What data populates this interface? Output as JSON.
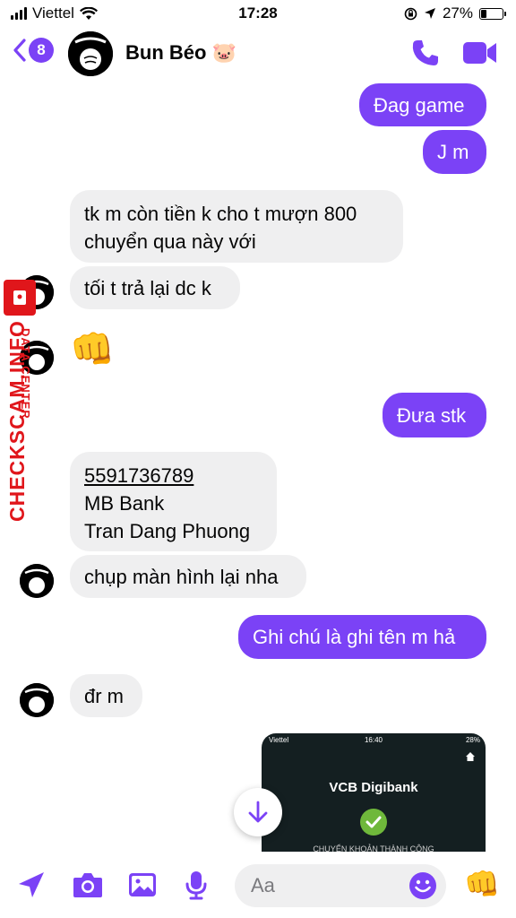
{
  "status_bar": {
    "carrier": "Viettel",
    "time": "17:28",
    "battery_percent": "27%",
    "battery_level": 0.27
  },
  "header": {
    "unread_count": "8",
    "contact_name": "Bun Béo 🐷"
  },
  "messages": [
    {
      "dir": "sent",
      "text": "Đag game"
    },
    {
      "dir": "sent",
      "text": "J m"
    },
    {
      "dir": "received",
      "lines": [
        "tk m còn tiền k cho t mượn 800",
        "chuyển qua này với"
      ]
    },
    {
      "dir": "received",
      "text": "tối t trả lại dc k"
    },
    {
      "dir": "received",
      "text": "👊"
    },
    {
      "dir": "sent",
      "text": "Đưa stk"
    },
    {
      "dir": "received",
      "lines": [
        "5591736789",
        "MB Bank",
        "Tran Dang Phuong"
      ]
    },
    {
      "dir": "received",
      "text": "chụp màn hình lại nha"
    },
    {
      "dir": "sent",
      "text": "Ghi chú là ghi tên m hả"
    },
    {
      "dir": "received",
      "text": "đr m"
    }
  ],
  "attachment": {
    "carrier": "Viettel",
    "time": "16:40",
    "battery": "28%",
    "brand": "VCB Digibank",
    "caption": "CHUYỂN KHOẢN THÀNH CÔNG"
  },
  "watermark": {
    "text": "CHECKSCAM.INFO",
    "subtext": "DATA CENTER"
  },
  "composer": {
    "placeholder": "Aa",
    "like_emoji": "👊"
  },
  "colors": {
    "accent": "#7b42f6",
    "received_bubble": "#efeff0",
    "watermark": "#e0161b"
  },
  "icons": [
    "back-chevron-icon",
    "phone-icon",
    "video-camera-icon",
    "location-arrow-icon",
    "camera-icon",
    "photo-icon",
    "microphone-icon",
    "emoji-icon",
    "arrow-down-icon",
    "checkmark-icon"
  ]
}
